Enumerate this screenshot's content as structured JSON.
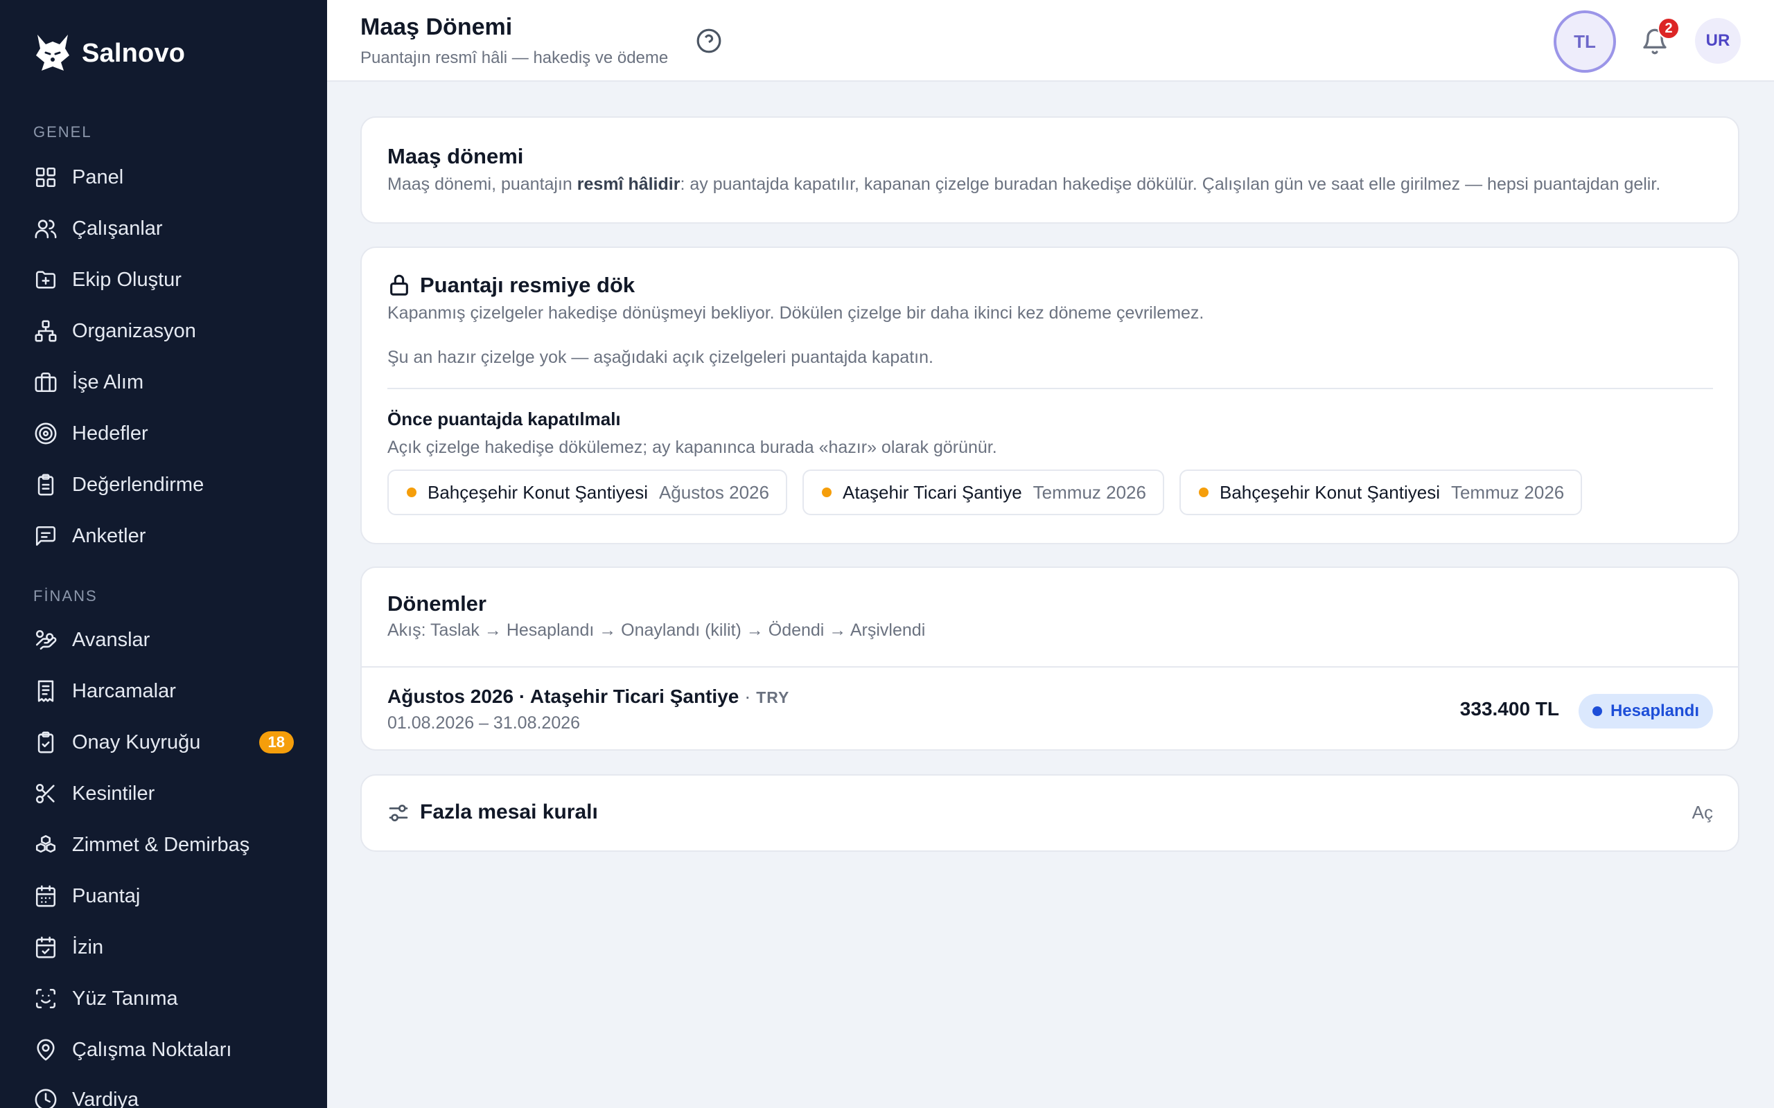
{
  "brand": {
    "name": "Salnovo"
  },
  "sidebar": {
    "sections": [
      {
        "label": "GENEL",
        "items": [
          {
            "label": "Panel",
            "icon": "grid-icon"
          },
          {
            "label": "Çalışanlar",
            "icon": "users-icon"
          },
          {
            "label": "Ekip Oluştur",
            "icon": "folder-plus-icon"
          },
          {
            "label": "Organizasyon",
            "icon": "org-chart-icon"
          },
          {
            "label": "İşe Alım",
            "icon": "briefcase-icon"
          },
          {
            "label": "Hedefler",
            "icon": "target-icon"
          },
          {
            "label": "Değerlendirme",
            "icon": "clipboard-icon"
          },
          {
            "label": "Anketler",
            "icon": "message-icon"
          }
        ]
      },
      {
        "label": "FİNANS",
        "items": [
          {
            "label": "Avanslar",
            "icon": "hand-coins-icon"
          },
          {
            "label": "Harcamalar",
            "icon": "receipt-icon"
          },
          {
            "label": "Onay Kuyruğu",
            "icon": "clipboard-check-icon",
            "badge": "18"
          },
          {
            "label": "Kesintiler",
            "icon": "scissors-icon"
          },
          {
            "label": "Zimmet & Demirbaş",
            "icon": "boxes-icon"
          },
          {
            "label": "Puantaj",
            "icon": "calendar-icon"
          },
          {
            "label": "İzin",
            "icon": "calendar-check-icon"
          },
          {
            "label": "Yüz Tanıma",
            "icon": "face-scan-icon"
          },
          {
            "label": "Çalışma Noktaları",
            "icon": "map-pin-icon"
          },
          {
            "label": "Vardiya",
            "icon": "clock-icon"
          }
        ]
      }
    ]
  },
  "header": {
    "title": "Maaş Dönemi",
    "subtitle": "Puantajın resmî hâli — hakediş ve ödeme",
    "currency": "TL",
    "notifications_count": "2",
    "user_initials": "UR"
  },
  "intro": {
    "title": "Maaş dönemi",
    "text_before": "Maaş dönemi, puantajın ",
    "text_bold": "resmî hâlidir",
    "text_after": ": ay puantajda kapatılır, kapanan çizelge buradan hakedişe dökülür. Çalışılan gün ve saat elle girilmez — hepsi puantajdan gelir."
  },
  "post": {
    "title": "Puantajı resmiye dök",
    "description": "Kapanmış çizelgeler hakedişe dönüşmeyi bekliyor. Dökülen çizelge bir daha ikinci kez döneme çevrilemez.",
    "empty_text": "Şu an hazır çizelge yok — aşağıdaki açık çizelgeleri puantajda kapatın.",
    "pending_title": "Önce puantajda kapatılmalı",
    "pending_desc": "Açık çizelge hakedişe dökülemez; ay kapanınca burada «hazır» olarak görünür.",
    "chips": [
      {
        "name": "Bahçeşehir Konut Şantiyesi",
        "period": "Ağustos 2026"
      },
      {
        "name": "Ataşehir Ticari Şantiye",
        "period": "Temmuz 2026"
      },
      {
        "name": "Bahçeşehir Konut Şantiyesi",
        "period": "Temmuz 2026"
      }
    ],
    "dot_color": "#f59e0b"
  },
  "periods": {
    "title": "Dönemler",
    "flow": "Akış: Taslak → Hesaplandı → Onaylandı (kilit) → Ödendi → Arşivlendi",
    "rows": [
      {
        "month": "Ağustos 2026",
        "separator": " · ",
        "site": "Ataşehir Ticari Şantiye",
        "currency_sep": " · ",
        "currency": "TRY",
        "dates": "01.08.2026 – 31.08.2026",
        "amount": "333.400 TL",
        "status": "Hesaplandı",
        "status_color": "#1d4ed8"
      }
    ]
  },
  "overtime": {
    "title": "Fazla mesai kuralı",
    "action": "Aç"
  }
}
